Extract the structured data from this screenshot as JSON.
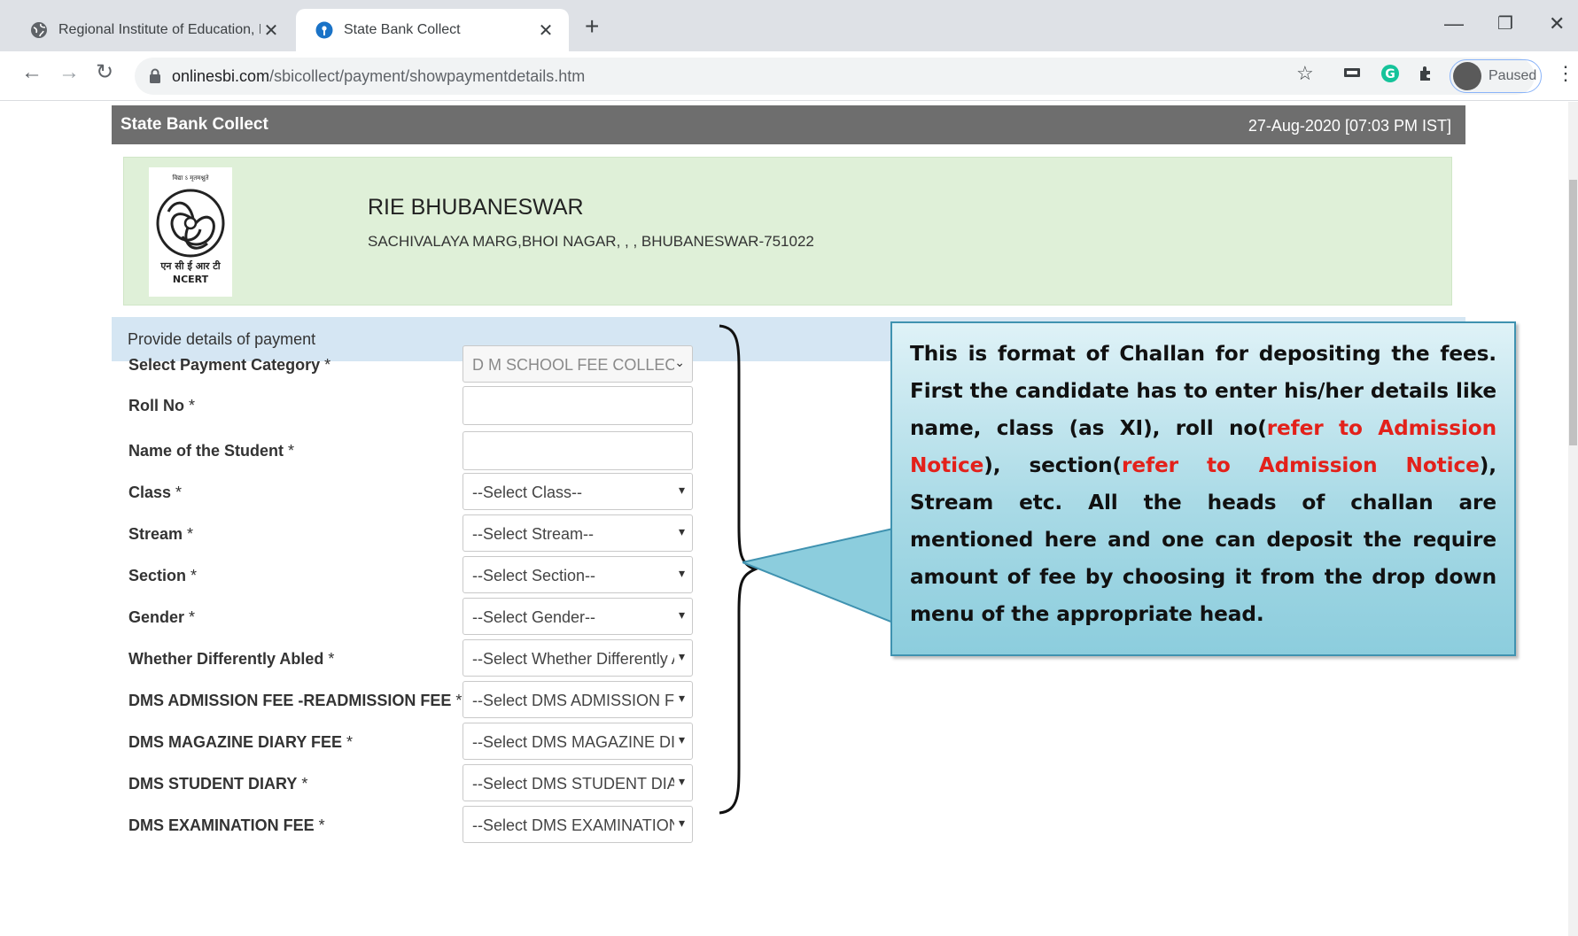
{
  "browser": {
    "tabs": [
      {
        "title": "Regional Institute of Education, B",
        "active": false
      },
      {
        "title": "State Bank Collect",
        "active": true
      }
    ],
    "url_domain": "onlinesbi.com",
    "url_path": "/sbicollect/payment/showpaymentdetails.htm",
    "profile_status": "Paused"
  },
  "header": {
    "brand": "State Bank Collect",
    "datetime": "27-Aug-2020 [07:03 PM IST]"
  },
  "institute": {
    "logo_text_top": "विद्या ऽ मृतमश्नुते",
    "logo_text_bottom": "एन सी ई आर टी",
    "logo_text_ncert": "NCERT",
    "name": "RIE BHUBANESWAR",
    "address": "SACHIVALAYA MARG,BHOI NAGAR, , , BHUBANESWAR-751022"
  },
  "section_title": "Provide details of payment",
  "form": {
    "rows": [
      {
        "label": "Select Payment Category",
        "req": " *",
        "type": "select",
        "value": "D M SCHOOL FEE COLLEC",
        "disabled": true
      },
      {
        "label": "Roll No",
        "req": " *",
        "type": "text",
        "value": ""
      },
      {
        "label": "Name of the Student",
        "req": " *",
        "type": "text",
        "value": ""
      },
      {
        "label": "Class",
        "req": " *",
        "type": "select",
        "value": "--Select Class--"
      },
      {
        "label": "Stream",
        "req": " *",
        "type": "select",
        "value": "--Select Stream--"
      },
      {
        "label": "Section",
        "req": " *",
        "type": "select",
        "value": "--Select Section--"
      },
      {
        "label": "Gender",
        "req": " *",
        "type": "select",
        "value": "--Select Gender--"
      },
      {
        "label": "Whether Differently Abled",
        "req": " *",
        "type": "select",
        "value": "--Select Whether Differently Abl"
      },
      {
        "label": "DMS ADMISSION FEE -READMISSION FEE",
        "req": " *",
        "type": "select",
        "value": "--Select DMS ADMISSION FEE"
      },
      {
        "label": "DMS MAGAZINE DIARY FEE",
        "req": " *",
        "type": "select",
        "value": "--Select DMS MAGAZINE DIAR"
      },
      {
        "label": "DMS STUDENT DIARY",
        "req": " *",
        "type": "select",
        "value": "--Select DMS STUDENT DIARY"
      },
      {
        "label": "DMS EXAMINATION FEE",
        "req": " *",
        "type": "select",
        "value": "--Select DMS EXAMINATION FE"
      }
    ]
  },
  "callout": {
    "p1": "This is format of Challan for depositing the fees. First the candidate has to enter his/her details like name, class (as XI), roll no(",
    "red1": "refer to Admission Notice",
    "p2": "), section(",
    "red2": "refer to Admission Notice",
    "p3": "), Stream  etc. All the heads of challan are mentioned here and one can deposit  the require amount of fee by choosing it from the drop down menu of the appropriate head."
  },
  "colors": {
    "header_bg": "#6e6e6e",
    "institute_bg": "#dff0d8",
    "section_bg": "#d5e6f3",
    "callout_border": "#3f92b0",
    "callout_highlight": "#e3211a"
  },
  "icons": [
    "globe-icon",
    "sbi-logo-icon",
    "close-icon",
    "new-tab-icon",
    "minimize-icon",
    "restore-icon",
    "window-close-icon",
    "back-icon",
    "forward-icon",
    "reload-icon",
    "lock-icon",
    "star-icon",
    "cast-icon",
    "grammarly-icon",
    "extensions-icon",
    "avatar",
    "menu-icon",
    "ncert-logo",
    "chevron-down-icon"
  ]
}
